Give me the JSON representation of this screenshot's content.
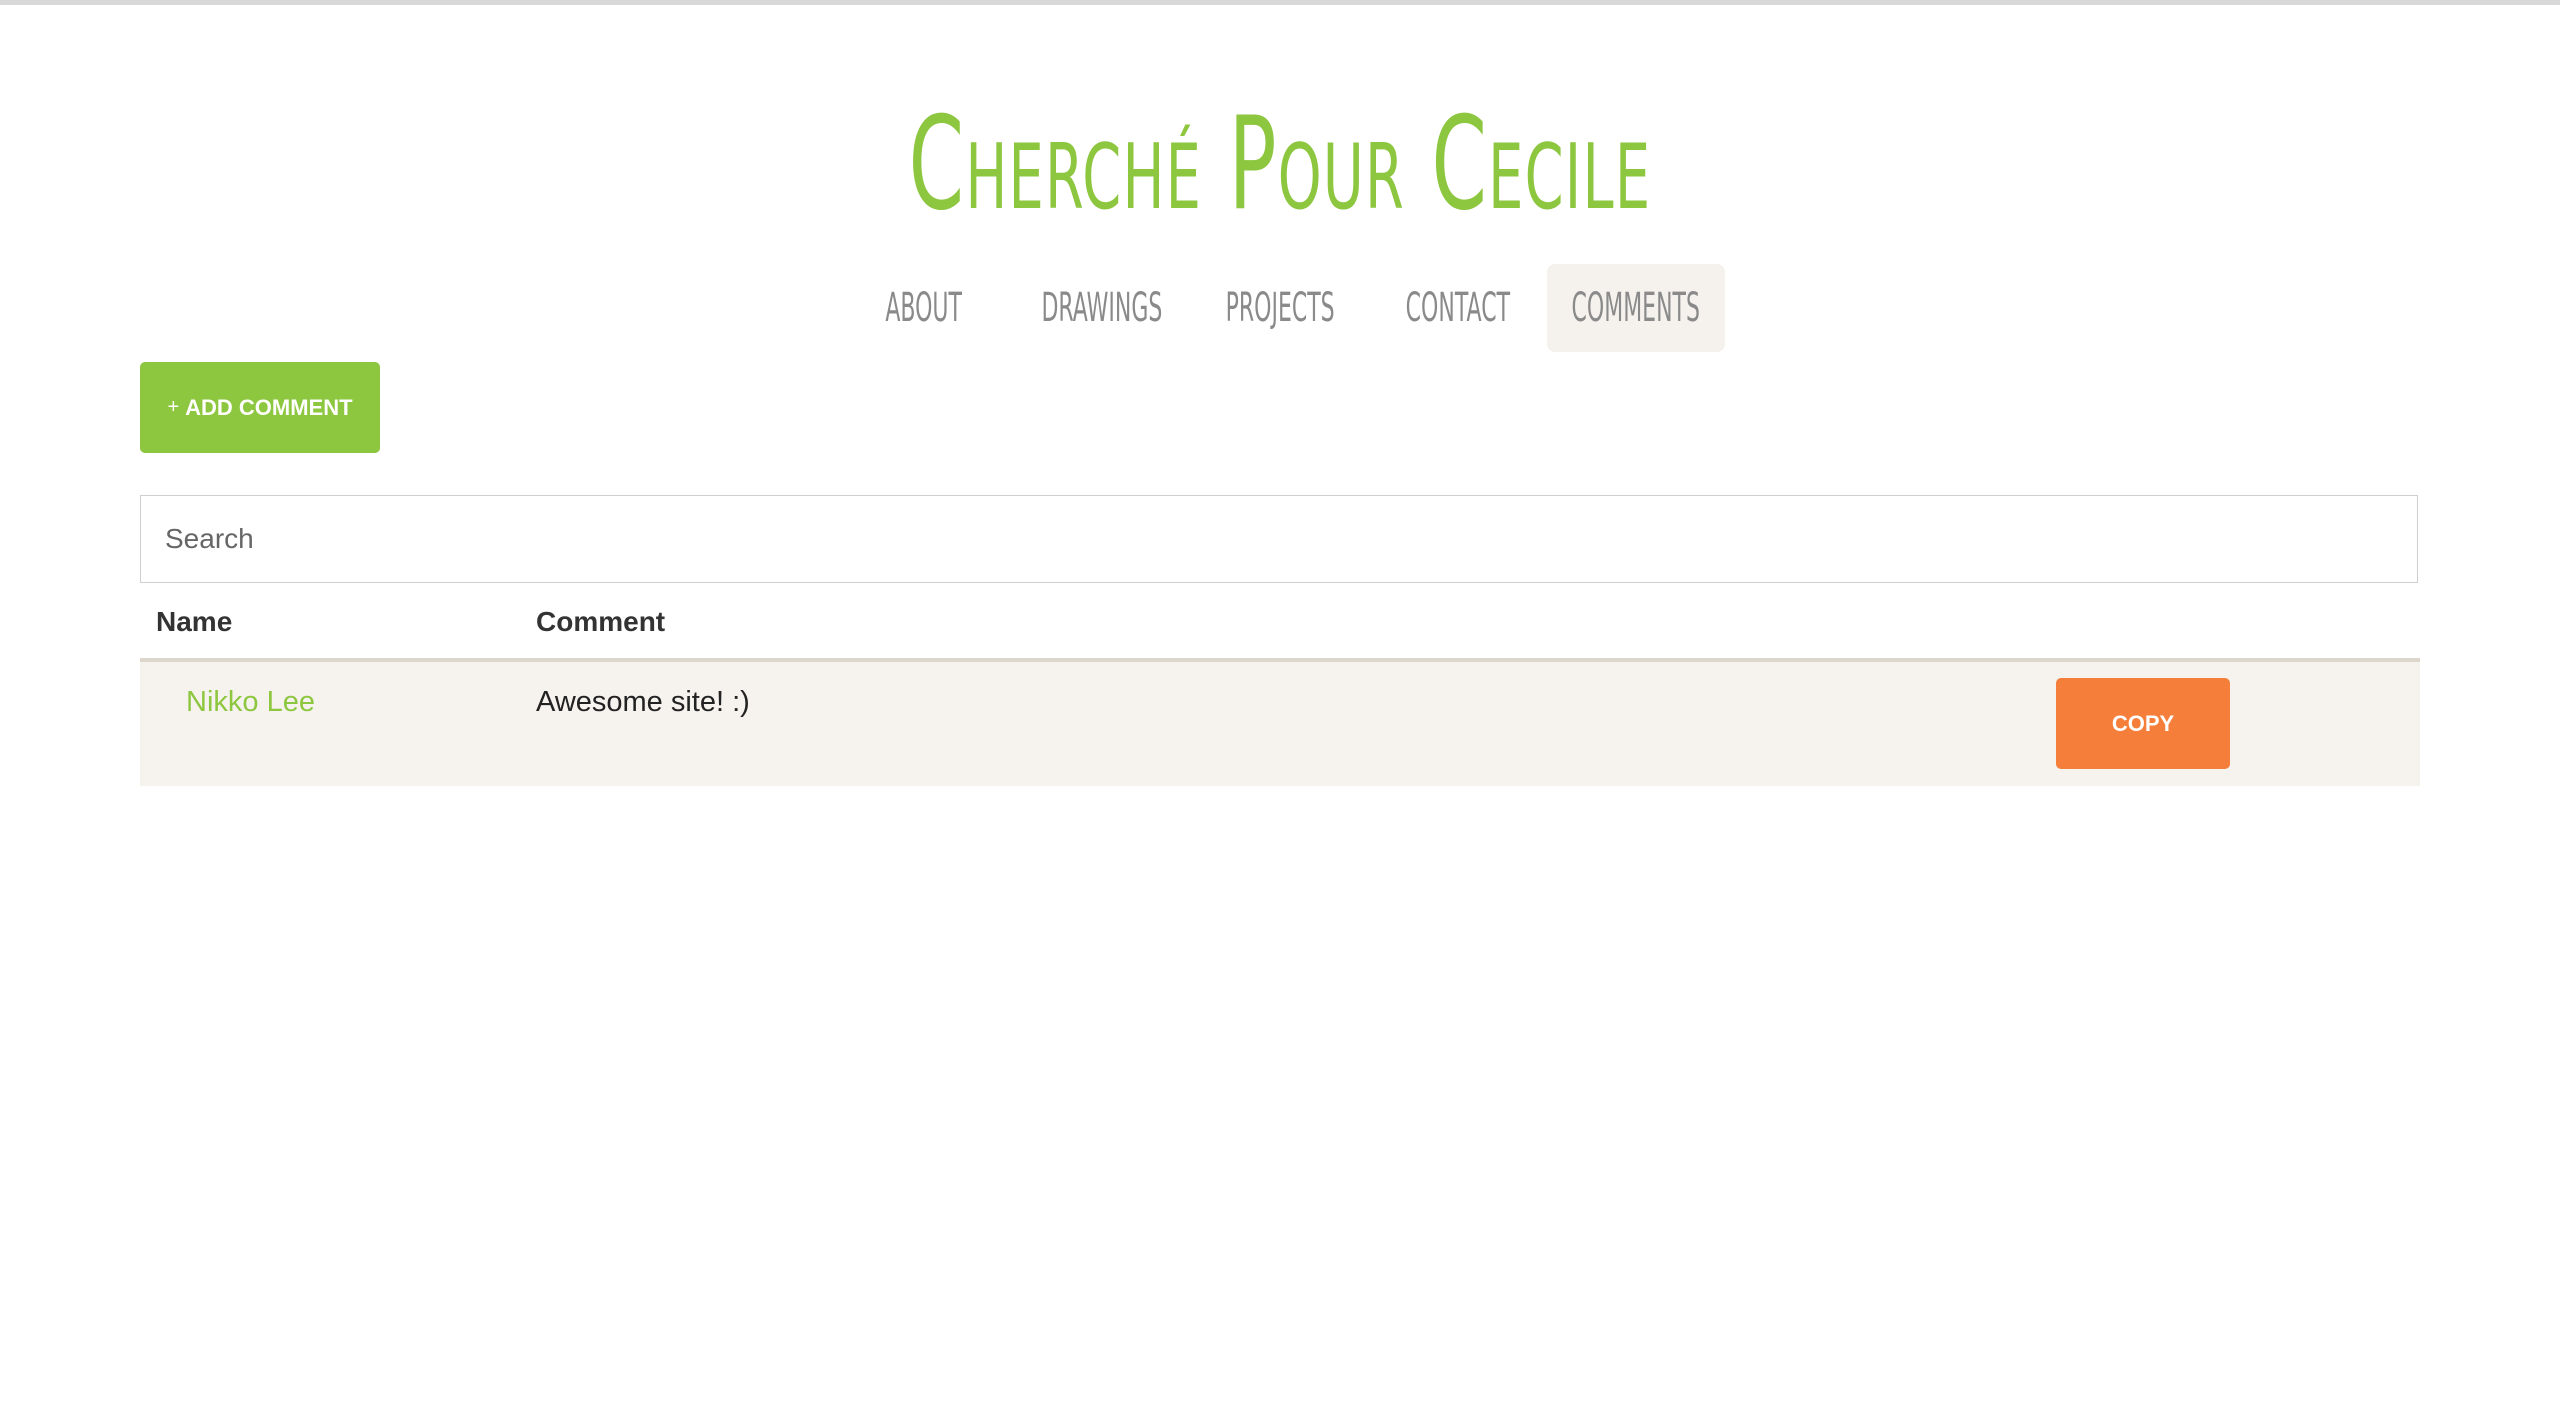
{
  "site": {
    "title": "Cherché Pour Cecile"
  },
  "nav": {
    "items": [
      {
        "label": "About"
      },
      {
        "label": "Drawings"
      },
      {
        "label": "Projects"
      },
      {
        "label": "Contact"
      },
      {
        "label": "Comments",
        "active": true
      }
    ]
  },
  "actions": {
    "add_icon": "+",
    "add_label": "Add Comment"
  },
  "search": {
    "placeholder": "Search",
    "value": ""
  },
  "table": {
    "headers": [
      "Name",
      "Comment"
    ],
    "rows": [
      {
        "name": "Nikko Lee",
        "comment": "Awesome site! :)",
        "action_label": "COPY"
      }
    ]
  },
  "colors": {
    "brand_green": "#8dc63f",
    "copy_orange": "#f47e3a",
    "row_bg": "#f6f3ef"
  }
}
